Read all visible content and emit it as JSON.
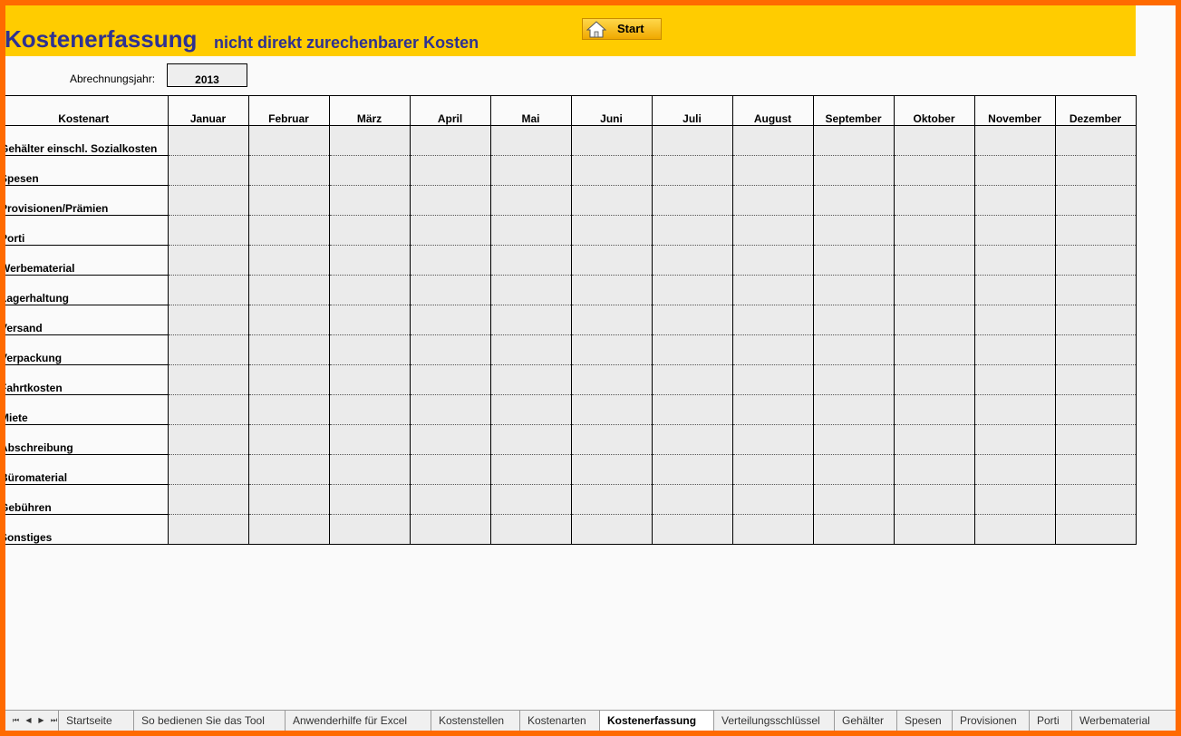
{
  "header": {
    "title_main": "Kostenerfassung",
    "title_sub": "nicht direkt zurechenbarer Kosten",
    "start_label": "Start",
    "year_label": "Abrechnungsjahr:",
    "year_value": "2013"
  },
  "table": {
    "label_header": "Kostenart",
    "months": [
      "Januar",
      "Februar",
      "März",
      "April",
      "Mai",
      "Juni",
      "Juli",
      "August",
      "September",
      "Oktober",
      "November",
      "Dezember"
    ],
    "rows": [
      "Gehälter einschl. Sozialkosten",
      "Spesen",
      "Provisionen/Prämien",
      "Porti",
      "Werbematerial",
      "Lagerhaltung",
      "Versand",
      "Verpackung",
      "Fahrtkosten",
      "Miete",
      "Abschreibung",
      "Büromaterial",
      "Gebühren",
      "Sonstiges"
    ]
  },
  "tabs": {
    "nav": [
      "⏮",
      "◀",
      "▶",
      "⏭"
    ],
    "items": [
      {
        "label": "Startseite",
        "active": false
      },
      {
        "label": "So bedienen Sie das Tool",
        "active": false
      },
      {
        "label": "Anwenderhilfe für Excel",
        "active": false
      },
      {
        "label": "Kostenstellen",
        "active": false
      },
      {
        "label": "Kostenarten",
        "active": false
      },
      {
        "label": "Kostenerfassung",
        "active": true
      },
      {
        "label": "Verteilungsschlüssel",
        "active": false
      },
      {
        "label": "Gehälter",
        "active": false
      },
      {
        "label": "Spesen",
        "active": false
      },
      {
        "label": "Provisionen",
        "active": false
      },
      {
        "label": "Porti",
        "active": false
      },
      {
        "label": "Werbematerial",
        "active": false
      }
    ]
  },
  "colors": {
    "frame": "#ff6a00",
    "banner": "#ffcc00",
    "title": "#2e3192",
    "input_cell": "#ebebeb"
  },
  "icons": {
    "start_button": "house-icon"
  }
}
